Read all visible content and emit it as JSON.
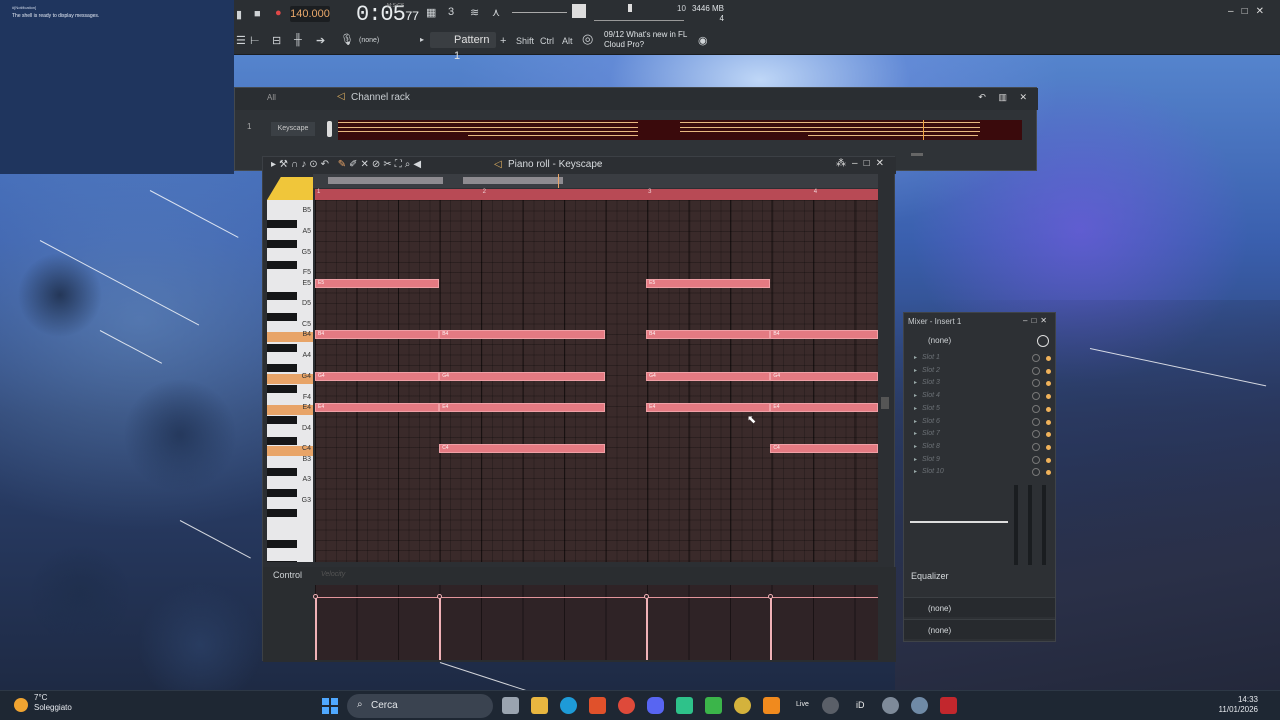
{
  "notification": {
    "title": "#[Notification]",
    "message": "The shell is ready to display messages."
  },
  "toolbar": {
    "tempo": "140.000",
    "time_main": "0:05",
    "time_sub": "77",
    "time_format": "M:S:CS",
    "pattern": "Pattern 1",
    "none_label": "(none)",
    "shift": "Shift",
    "ctrl": "Ctrl",
    "alt": "Alt",
    "news_date": "09/12",
    "news_line1": "What's new in FL",
    "news_line2": "Cloud Pro?",
    "cpu_value": "10",
    "memory": "3446 MB",
    "poly": "4"
  },
  "channel_rack": {
    "filter": "All",
    "title": "Channel rack",
    "channel_number": "1",
    "channel_name": "Keyscape"
  },
  "piano_roll": {
    "title": "Piano roll - Keyscape",
    "bars": [
      "1",
      "2",
      "3",
      "4"
    ],
    "keys": [
      "B5",
      "A5",
      "G5",
      "F5",
      "E5",
      "D5",
      "C5",
      "B4",
      "A4",
      "G4",
      "F4",
      "E4",
      "D4",
      "C4",
      "B3",
      "A3",
      "G3"
    ],
    "highlighted_keys": [
      "B4",
      "G4",
      "E4",
      "C4"
    ],
    "notes": [
      {
        "pitch": "E5",
        "start": 1.0,
        "length": 0.75,
        "label": "E5"
      },
      {
        "pitch": "E5",
        "start": 3.0,
        "length": 0.75,
        "label": "E5"
      },
      {
        "pitch": "B4",
        "start": 1.0,
        "length": 0.75,
        "label": "B4"
      },
      {
        "pitch": "B4",
        "start": 1.75,
        "length": 1.0,
        "label": "B4"
      },
      {
        "pitch": "B4",
        "start": 3.0,
        "length": 0.75,
        "label": "B4"
      },
      {
        "pitch": "B4",
        "start": 3.75,
        "length": 0.65,
        "label": "B4"
      },
      {
        "pitch": "G4",
        "start": 1.0,
        "length": 0.75,
        "label": "G4"
      },
      {
        "pitch": "G4",
        "start": 1.75,
        "length": 1.0,
        "label": "G4"
      },
      {
        "pitch": "G4",
        "start": 3.0,
        "length": 0.75,
        "label": "G4"
      },
      {
        "pitch": "G4",
        "start": 3.75,
        "length": 0.65,
        "label": "G4"
      },
      {
        "pitch": "E4",
        "start": 1.0,
        "length": 0.75,
        "label": "E4"
      },
      {
        "pitch": "E4",
        "start": 1.75,
        "length": 1.0,
        "label": "E4"
      },
      {
        "pitch": "E4",
        "start": 3.0,
        "length": 0.75,
        "label": "E4"
      },
      {
        "pitch": "E4",
        "start": 3.75,
        "length": 0.65,
        "label": "E4"
      },
      {
        "pitch": "C4",
        "start": 1.75,
        "length": 1.0,
        "label": "C4"
      },
      {
        "pitch": "C4",
        "start": 3.75,
        "length": 0.65,
        "label": "C4"
      }
    ],
    "control_label": "Control",
    "control_param": "Velocity",
    "velocity_positions": [
      1.0,
      1.75,
      3.0,
      3.75
    ]
  },
  "mixer": {
    "title": "Mixer - Insert 1",
    "input": "(none)",
    "slots": [
      "Slot 1",
      "Slot 2",
      "Slot 3",
      "Slot 4",
      "Slot 5",
      "Slot 6",
      "Slot 7",
      "Slot 8",
      "Slot 9",
      "Slot 10"
    ],
    "eq_label": "Equalizer",
    "output1": "(none)",
    "output2": "(none)"
  },
  "taskbar": {
    "temperature": "7°C",
    "weather": "Soleggiato",
    "search": "Cerca",
    "time": "14:33",
    "date": "11/01/2026",
    "live_label": "Live",
    "id_label": "iD"
  },
  "colors": {
    "note": "#e47a82",
    "key_highlight": "#e8a468",
    "timeline": "#b84a55",
    "accent": "#f0c63a"
  }
}
